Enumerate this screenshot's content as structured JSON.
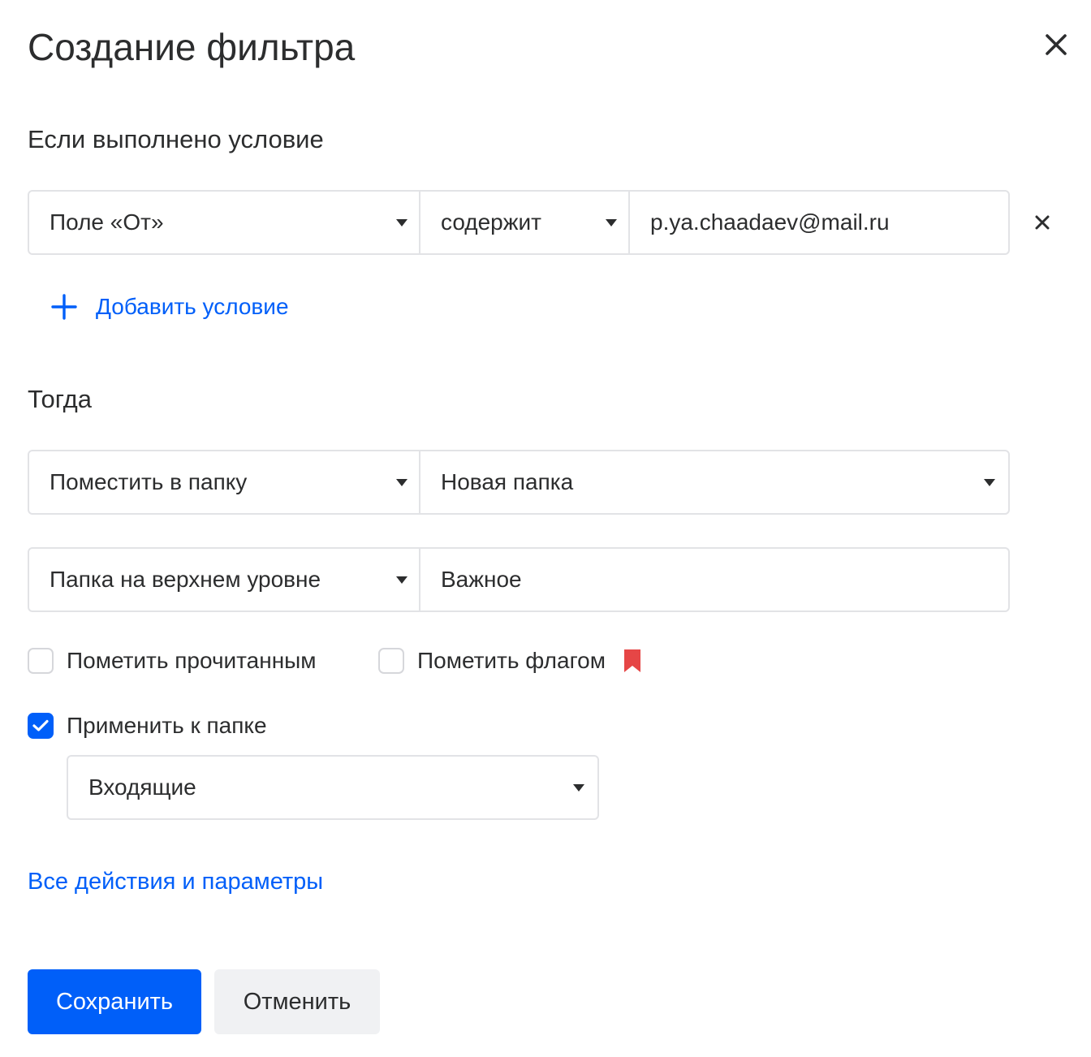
{
  "dialog": {
    "title": "Создание фильтра",
    "close_icon": "close-icon"
  },
  "condition": {
    "section_label": "Если выполнено условие",
    "field": "Поле «От»",
    "operator": "содержит",
    "value": "p.ya.chaadaev@mail.ru",
    "add_label": "Добавить условие"
  },
  "action": {
    "section_label": "Тогда",
    "type": "Поместить в папку",
    "target_folder": "Новая папка",
    "folder_level": "Папка на верхнем уровне",
    "folder_name": "Важное"
  },
  "options": {
    "mark_read": {
      "label": "Пометить прочитанным",
      "checked": false
    },
    "mark_flag": {
      "label": "Пометить флагом",
      "checked": false,
      "flag_color": "#e64646"
    },
    "apply_to_folder": {
      "label": "Применить к папке",
      "checked": true
    },
    "apply_folder_value": "Входящие"
  },
  "links": {
    "all_actions": "Все действия и параметры"
  },
  "buttons": {
    "save": "Сохранить",
    "cancel": "Отменить"
  },
  "colors": {
    "accent": "#005ff9",
    "text": "#2c2d2e",
    "border": "#e2e3e6",
    "cancel_bg": "#f0f1f3"
  }
}
